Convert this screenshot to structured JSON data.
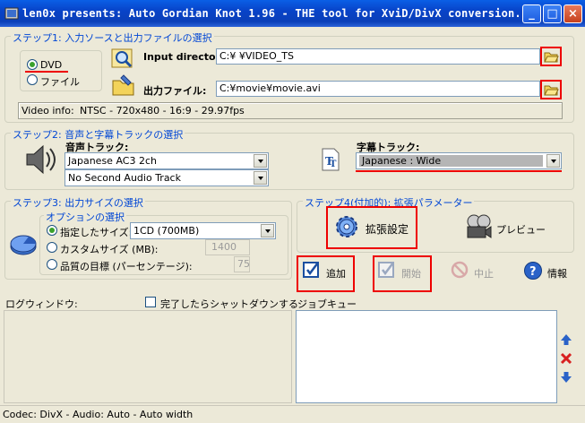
{
  "window": {
    "title": "len0x presents: Auto Gordian Knot 1.96 - THE tool for XviD/DivX conversion."
  },
  "step1": {
    "title": "ステップ1: 入力ソースと出力ファイルの選択",
    "source_dvd": "DVD",
    "source_file": "ファイル",
    "input_label": "Input directory:",
    "input_value": "C:¥      ¥VIDEO_TS",
    "output_label": "出力ファイル:",
    "output_value": "C:¥movie¥movie.avi",
    "video_info_label": "Video info:",
    "video_info_value": "NTSC - 720x480 - 16:9 - 29.97fps"
  },
  "step2": {
    "title": "ステップ2: 音声と字幕トラックの選択",
    "audio_label": "音声トラック:",
    "audio_track1": "Japanese AC3 2ch",
    "audio_track2": "No Second Audio Track",
    "subtitle_label": "字幕トラック:",
    "subtitle_value": "Japanese : Wide"
  },
  "step3": {
    "title": "ステップ3: 出力サイズの選択",
    "options_title": "オプションの選択",
    "opt_size": "指定したサイズ:",
    "opt_size_value": "1CD (700MB)",
    "opt_custom": "カスタムサイズ (MB):",
    "opt_custom_value": "1400",
    "opt_quality": "品質の目標 (パーセンテージ):",
    "opt_quality_value": "75"
  },
  "step4": {
    "title": "ステップ4(付加的): 拡張パラメーター",
    "advanced": "拡張設定",
    "preview": "プレビュー"
  },
  "actions": {
    "add": "追加",
    "start": "開始",
    "stop": "中止",
    "info": "情報"
  },
  "log": {
    "title": "ログウィンドウ:",
    "shutdown": "完了したらシャットダウンする"
  },
  "queue": {
    "title": "ジョブキュー"
  },
  "statusbar": {
    "text": "Codec: DivX -   Audio: Auto -   Auto width"
  }
}
